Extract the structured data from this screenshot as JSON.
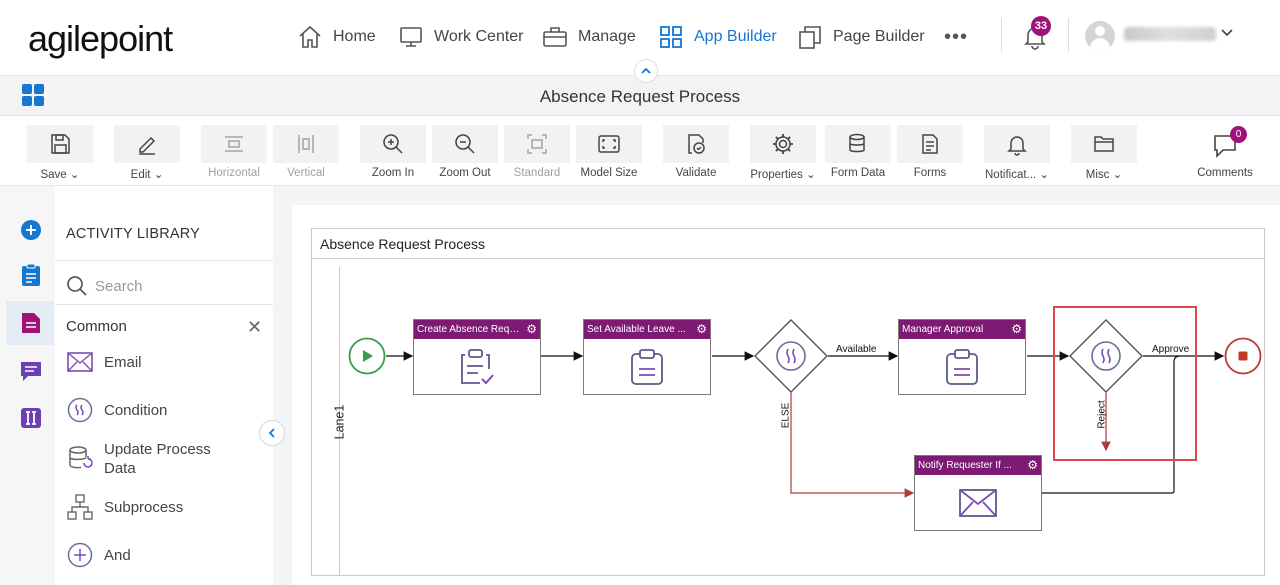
{
  "brand": {
    "logo_text": "agilepoint"
  },
  "nav": {
    "items": [
      {
        "label": "Home",
        "icon": "home-icon"
      },
      {
        "label": "Work Center",
        "icon": "monitor-icon"
      },
      {
        "label": "Manage",
        "icon": "briefcase-icon"
      },
      {
        "label": "App Builder",
        "icon": "apps-grid-icon",
        "active": true
      },
      {
        "label": "Page Builder",
        "icon": "pages-icon"
      }
    ],
    "more": "•••",
    "notifications_count": "33",
    "accent_color": "#1677d2",
    "badge_color": "#a0127a"
  },
  "titlebar": {
    "title": "Absence Request Process"
  },
  "toolbar": {
    "save": "Save",
    "edit": "Edit",
    "horizontal": "Horizontal",
    "vertical": "Vertical",
    "zoom_in": "Zoom In",
    "zoom_out": "Zoom Out",
    "standard": "Standard",
    "model_size": "Model Size",
    "validate": "Validate",
    "properties": "Properties",
    "form_data": "Form Data",
    "forms": "Forms",
    "notifications": "Notificat...",
    "misc": "Misc",
    "comments": "Comments",
    "comments_count": "0"
  },
  "library": {
    "title": "ACTIVITY LIBRARY",
    "search_placeholder": "Search",
    "group": "Common",
    "items": [
      {
        "label": "Email",
        "icon": "envelope-icon"
      },
      {
        "label": "Condition",
        "icon": "condition-icon"
      },
      {
        "label": "Update Process Data",
        "icon": "database-refresh-icon"
      },
      {
        "label": "Subprocess",
        "icon": "hierarchy-icon"
      },
      {
        "label": "And",
        "icon": "plus-circle-icon"
      }
    ]
  },
  "process": {
    "pool_title": "Absence Request Process",
    "lane": "Lane1",
    "tasks": [
      {
        "label": "Create Absence Reque..."
      },
      {
        "label": "Set Available Leave ..."
      },
      {
        "label": "Manager Approval"
      },
      {
        "label": "Notify Requester If ..."
      }
    ],
    "flows": {
      "available": "Available",
      "else": "ELSE",
      "approve": "Approve",
      "reject": "Reject"
    },
    "task_header_color": "#7d1a73",
    "selection_color": "#e04848"
  }
}
